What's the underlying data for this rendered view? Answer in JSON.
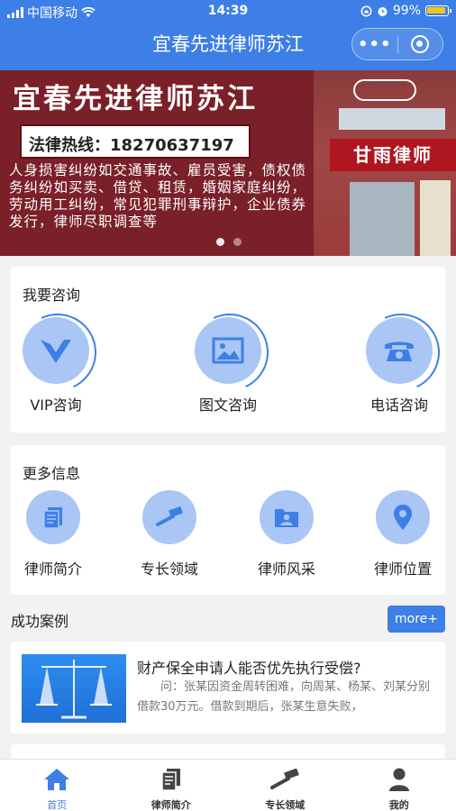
{
  "status_bar": {
    "carrier": "中国移动",
    "time": "14:39",
    "battery": "99%"
  },
  "nav": {
    "title": "宜春先进律师苏江",
    "more_icon": "more-dots-icon",
    "close_icon": "mini-program-close-icon"
  },
  "banner": {
    "title": "宜春先进律师苏江",
    "hotline": "法律热线：18270637197",
    "description": "人身损害纠纷如交通事故、雇员受害，债权债务纠纷如买卖、借贷、租赁，婚姻家庭纠纷，劳动用工纠纷，常见犯罪刑事辩护，企业债券发行，律师尽职调查等",
    "sign_text": "甘雨律师",
    "slide_count": 2,
    "active_slide": 1
  },
  "consult": {
    "title": "我要咨询",
    "items": [
      {
        "label": "VIP咨询",
        "icon": "vip-icon"
      },
      {
        "label": "图文咨询",
        "icon": "image-icon"
      },
      {
        "label": "电话咨询",
        "icon": "phone-icon"
      }
    ]
  },
  "more_info": {
    "title": "更多信息",
    "items": [
      {
        "label": "律师简介",
        "icon": "document-icon"
      },
      {
        "label": "专长领域",
        "icon": "gavel-icon"
      },
      {
        "label": "律师风采",
        "icon": "photo-folder-icon"
      },
      {
        "label": "律师位置",
        "icon": "location-pin-icon"
      }
    ]
  },
  "cases": {
    "title": "成功案例",
    "more_label": "more+",
    "items": [
      {
        "title": "财产保全申请人能否优先执行受偿?",
        "excerpt": "问：张某因资金周转困难，向周某、杨某、刘某分别借款30万元。借款到期后，张某生意失败，"
      }
    ]
  },
  "tabbar": {
    "items": [
      {
        "label": "首页",
        "icon": "home-icon",
        "active": true
      },
      {
        "label": "律师简介",
        "icon": "document-icon",
        "active": false
      },
      {
        "label": "专长领域",
        "icon": "gavel-icon",
        "active": false
      },
      {
        "label": "我的",
        "icon": "user-icon",
        "active": false
      }
    ]
  },
  "colors": {
    "primary": "#3d7fe6",
    "icon_bg": "#a9c6f5",
    "banner_bg": "#7a2028"
  }
}
